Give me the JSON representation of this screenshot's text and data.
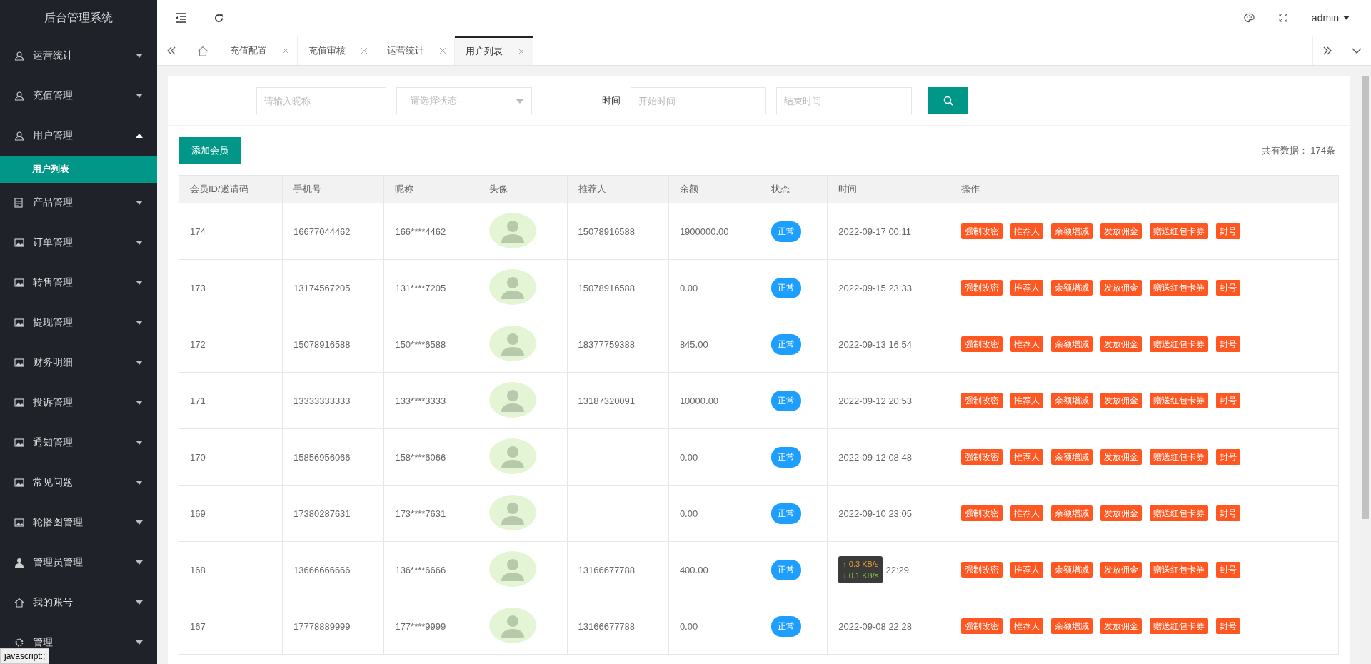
{
  "app": {
    "title": "后台管理系统"
  },
  "sidebar": [
    {
      "label": "运营统计",
      "expanded": false
    },
    {
      "label": "充值管理",
      "expanded": false
    },
    {
      "label": "用户管理",
      "expanded": true,
      "children": [
        {
          "label": "用户列表",
          "selected": true
        }
      ]
    },
    {
      "label": "产品管理",
      "expanded": false
    },
    {
      "label": "订单管理",
      "expanded": false
    },
    {
      "label": "转售管理",
      "expanded": false
    },
    {
      "label": "提现管理",
      "expanded": false
    },
    {
      "label": "财务明细",
      "expanded": false
    },
    {
      "label": "投诉管理",
      "expanded": false
    },
    {
      "label": "通知管理",
      "expanded": false
    },
    {
      "label": "常见问题",
      "expanded": false
    },
    {
      "label": "轮播图管理",
      "expanded": false
    },
    {
      "label": "管理员管理",
      "expanded": false
    },
    {
      "label": "我的账号",
      "expanded": false
    },
    {
      "label": "管理",
      "expanded": false
    }
  ],
  "status_tip": "javascript:;",
  "header": {
    "user": "admin"
  },
  "tabs": [
    {
      "label": "充值配置",
      "selected": false
    },
    {
      "label": "充值审核",
      "selected": false
    },
    {
      "label": "运营统计",
      "selected": false
    },
    {
      "label": "用户列表",
      "selected": true
    }
  ],
  "filters": {
    "nickname_placeholder": "请输入昵称",
    "status_placeholder": "--请选择状态--",
    "time_label": "时间",
    "start_placeholder": "开始时间",
    "end_placeholder": "结束时间"
  },
  "add_button": "添加会员",
  "total": "共有数据： 174条",
  "table": {
    "columns": [
      "会员ID/邀请码",
      "手机号",
      "昵称",
      "头像",
      "推荐人",
      "余额",
      "状态",
      "时间",
      "操作"
    ],
    "rows": [
      {
        "id": "174",
        "phone": "16677044462",
        "nickname": "166****4462",
        "referrer": "15078916588",
        "balance": "1900000.00",
        "status": "正常",
        "time": "2022-09-17 00:11",
        "actions": [
          "强制改密",
          "推荐人",
          "余额增减",
          "发放佣金",
          "赠送红包卡券",
          "封号"
        ]
      },
      {
        "id": "173",
        "phone": "13174567205",
        "nickname": "131****7205",
        "referrer": "15078916588",
        "balance": "0.00",
        "status": "正常",
        "time": "2022-09-15 23:33",
        "actions": [
          "强制改密",
          "推荐人",
          "余额增减",
          "发放佣金",
          "赠送红包卡券",
          "封号"
        ]
      },
      {
        "id": "172",
        "phone": "15078916588",
        "nickname": "150****6588",
        "referrer": "18377759388",
        "balance": "845.00",
        "status": "正常",
        "time": "2022-09-13 16:54",
        "actions": [
          "强制改密",
          "推荐人",
          "余额增减",
          "发放佣金",
          "赠送红包卡券",
          "封号"
        ]
      },
      {
        "id": "171",
        "phone": "13333333333",
        "nickname": "133****3333",
        "referrer": "13187320091",
        "balance": "10000.00",
        "status": "正常",
        "time": "2022-09-12 20:53",
        "actions": [
          "强制改密",
          "推荐人",
          "余额增减",
          "发放佣金",
          "赠送红包卡券",
          "封号"
        ]
      },
      {
        "id": "170",
        "phone": "15856956066",
        "nickname": "158****6066",
        "balance": "0.00",
        "status": "正常",
        "time": "2022-09-12 08:48",
        "actions": [
          "强制改密",
          "推荐人",
          "余额增减",
          "发放佣金",
          "赠送红包卡券",
          "封号"
        ]
      },
      {
        "id": "169",
        "phone": "17380287631",
        "nickname": "173****7631",
        "balance": "0.00",
        "status": "正常",
        "time": "2022-09-10 23:05",
        "actions": [
          "强制改密",
          "推荐人",
          "余额增减",
          "发放佣金",
          "赠送红包卡券",
          "封号"
        ]
      },
      {
        "id": "168",
        "phone": "13666666666",
        "nickname": "136****6666",
        "referrer": "13166677788",
        "balance": "400.00",
        "status": "正常",
        "time": "22:29",
        "net_speed": {
          "up": "↑ 0.3 KB/s",
          "down": "↓ 0.1 KB/s"
        },
        "actions": [
          "强制改密",
          "推荐人",
          "余额增减",
          "发放佣金",
          "赠送红包卡券",
          "封号"
        ]
      },
      {
        "id": "167",
        "phone": "17778889999",
        "nickname": "177****9999",
        "referrer": "13166677788",
        "balance": "0.00",
        "status": "正常",
        "time": "2022-09-08 22:28",
        "actions": [
          "强制改密",
          "推荐人",
          "余额增减",
          "发放佣金",
          "赠送红包卡券",
          "封号"
        ]
      }
    ]
  }
}
